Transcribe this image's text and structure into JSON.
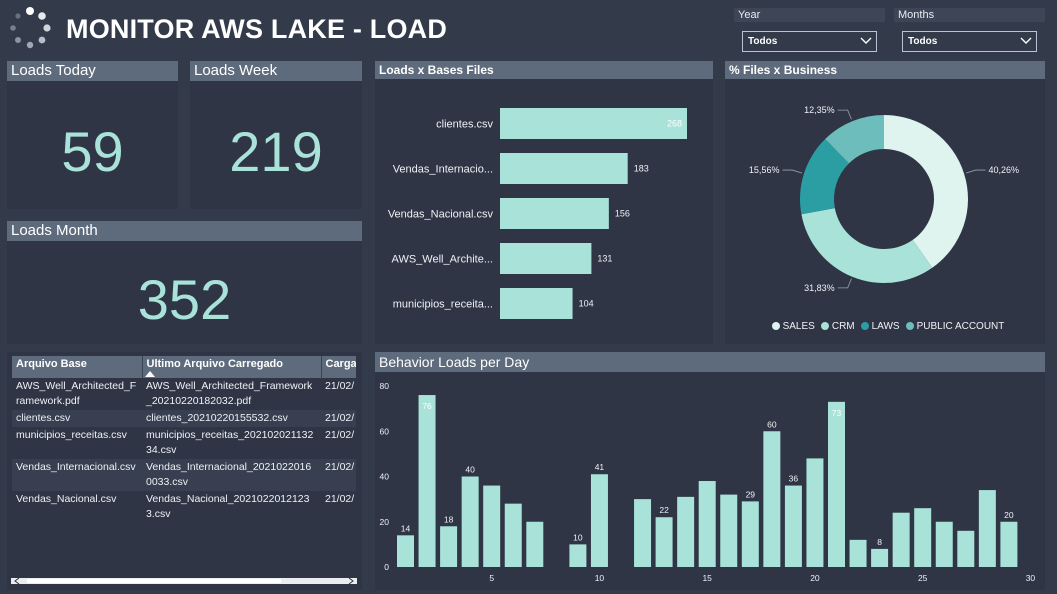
{
  "page_title": "MONITOR AWS LAKE - LOAD",
  "filters": {
    "year": {
      "label": "Year",
      "value": "Todos"
    },
    "months": {
      "label": "Months",
      "value": "Todos"
    }
  },
  "cards": {
    "today": {
      "label": "Loads Today",
      "value": "59"
    },
    "week": {
      "label": "Loads Week",
      "value": "219"
    },
    "month": {
      "label": "Loads Month",
      "value": "352"
    }
  },
  "colors": {
    "accent": "#a8e2d8",
    "panel": "#2f3545",
    "header": "#5e6b7c",
    "bg": "#333a4a"
  },
  "table": {
    "columns": [
      "Arquivo Base",
      "Ultimo Arquivo Carregado",
      "Carga"
    ],
    "rows": [
      [
        "AWS_Well_Architected_Framework.pdf",
        "AWS_Well_Architected_Framework_20210220182032.pdf",
        "21/02/"
      ],
      [
        "clientes.csv",
        "clientes_20210220155532.csv",
        "21/02/"
      ],
      [
        "municipios_receitas.csv",
        "municipios_receitas_20210202113234.csv",
        "21/02/"
      ],
      [
        "Vendas_Internacional.csv",
        "Vendas_Internacional_20210220160033.csv",
        "21/02/"
      ],
      [
        "Vendas_Nacional.csv",
        "Vendas_Nacional_20210220121233.csv",
        "21/02/"
      ]
    ]
  },
  "chart_data": [
    {
      "type": "bar",
      "orientation": "horizontal",
      "title": "Loads x Bases Files",
      "categories": [
        "clientes.csv",
        "Vendas_Internacio...",
        "Vendas_Nacional.csv",
        "AWS_Well_Archite...",
        "municipios_receita..."
      ],
      "values": [
        268,
        183,
        156,
        131,
        104
      ]
    },
    {
      "type": "pie",
      "title": "% Files x Business",
      "categories": [
        "SALES",
        "CRM",
        "LAWS",
        "PUBLIC ACCOUNT"
      ],
      "values": [
        40.26,
        31.83,
        15.56,
        12.35
      ],
      "labels": [
        "40,26%",
        "31,83%",
        "15,56%",
        "12,35%"
      ],
      "colors": [
        "#dff3ef",
        "#a8e2d8",
        "#2b9ea3",
        "#6cbdbb"
      ],
      "legend": "bottom"
    },
    {
      "type": "bar",
      "title": "Behavior Loads per Day",
      "x": [
        1,
        2,
        3,
        4,
        5,
        6,
        7,
        8,
        9,
        10,
        11,
        12,
        13,
        14,
        15,
        16,
        17,
        18,
        19,
        20,
        21,
        22,
        23,
        24,
        25,
        26,
        27,
        28,
        29,
        30
      ],
      "values": [
        14,
        76,
        18,
        40,
        36,
        28,
        20,
        null,
        10,
        41,
        null,
        30,
        22,
        31,
        38,
        32,
        29,
        60,
        36,
        48,
        73,
        12,
        8,
        24,
        26,
        20,
        16,
        34,
        20,
        null
      ],
      "data_labels": {
        "1": "14",
        "2": "76",
        "3": "18",
        "4": "40",
        "9": "10",
        "10": "41",
        "13": "22",
        "17": "29",
        "18": "60",
        "19": "36",
        "21": "73",
        "23": "8",
        "29": "20"
      },
      "y_ticks": [
        "0",
        "20",
        "40",
        "60",
        "80"
      ],
      "x_ticks": [
        "5",
        "10",
        "15",
        "20",
        "25",
        "30"
      ],
      "ylim": [
        0,
        80
      ],
      "grid": false
    }
  ]
}
